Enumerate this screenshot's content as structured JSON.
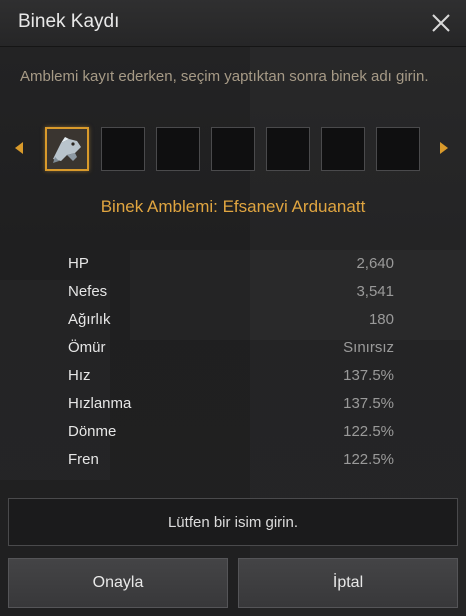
{
  "window": {
    "title": "Binek Kaydı",
    "close_icon": "close-icon"
  },
  "instruction": "Amblemi kayıt ederken, seçim yaptıktan sonra binek adı girin.",
  "emblem_slots": {
    "selected_index": 0,
    "count": 7,
    "left_arrow_icon": "chevron-left-icon",
    "right_arrow_icon": "chevron-right-icon"
  },
  "emblem_title": "Binek Amblemi: Efsanevi Arduanatt",
  "stats": [
    {
      "label": "HP",
      "value": "2,640"
    },
    {
      "label": "Nefes",
      "value": "3,541"
    },
    {
      "label": "Ağırlık",
      "value": "180"
    },
    {
      "label": "Ömür",
      "value": "Sınırsız"
    },
    {
      "label": "Hız",
      "value": "137.5%"
    },
    {
      "label": "Hızlanma",
      "value": "137.5%"
    },
    {
      "label": "Dönme",
      "value": "122.5%"
    },
    {
      "label": "Fren",
      "value": "122.5%"
    }
  ],
  "name_input": {
    "placeholder": "Lütfen bir isim girin.",
    "value": ""
  },
  "buttons": {
    "confirm": "Onayla",
    "cancel": "İptal"
  },
  "colors": {
    "accent": "#e0a540",
    "slot_border_selected": "#d99a2b",
    "instruction_text": "#a69a86"
  }
}
